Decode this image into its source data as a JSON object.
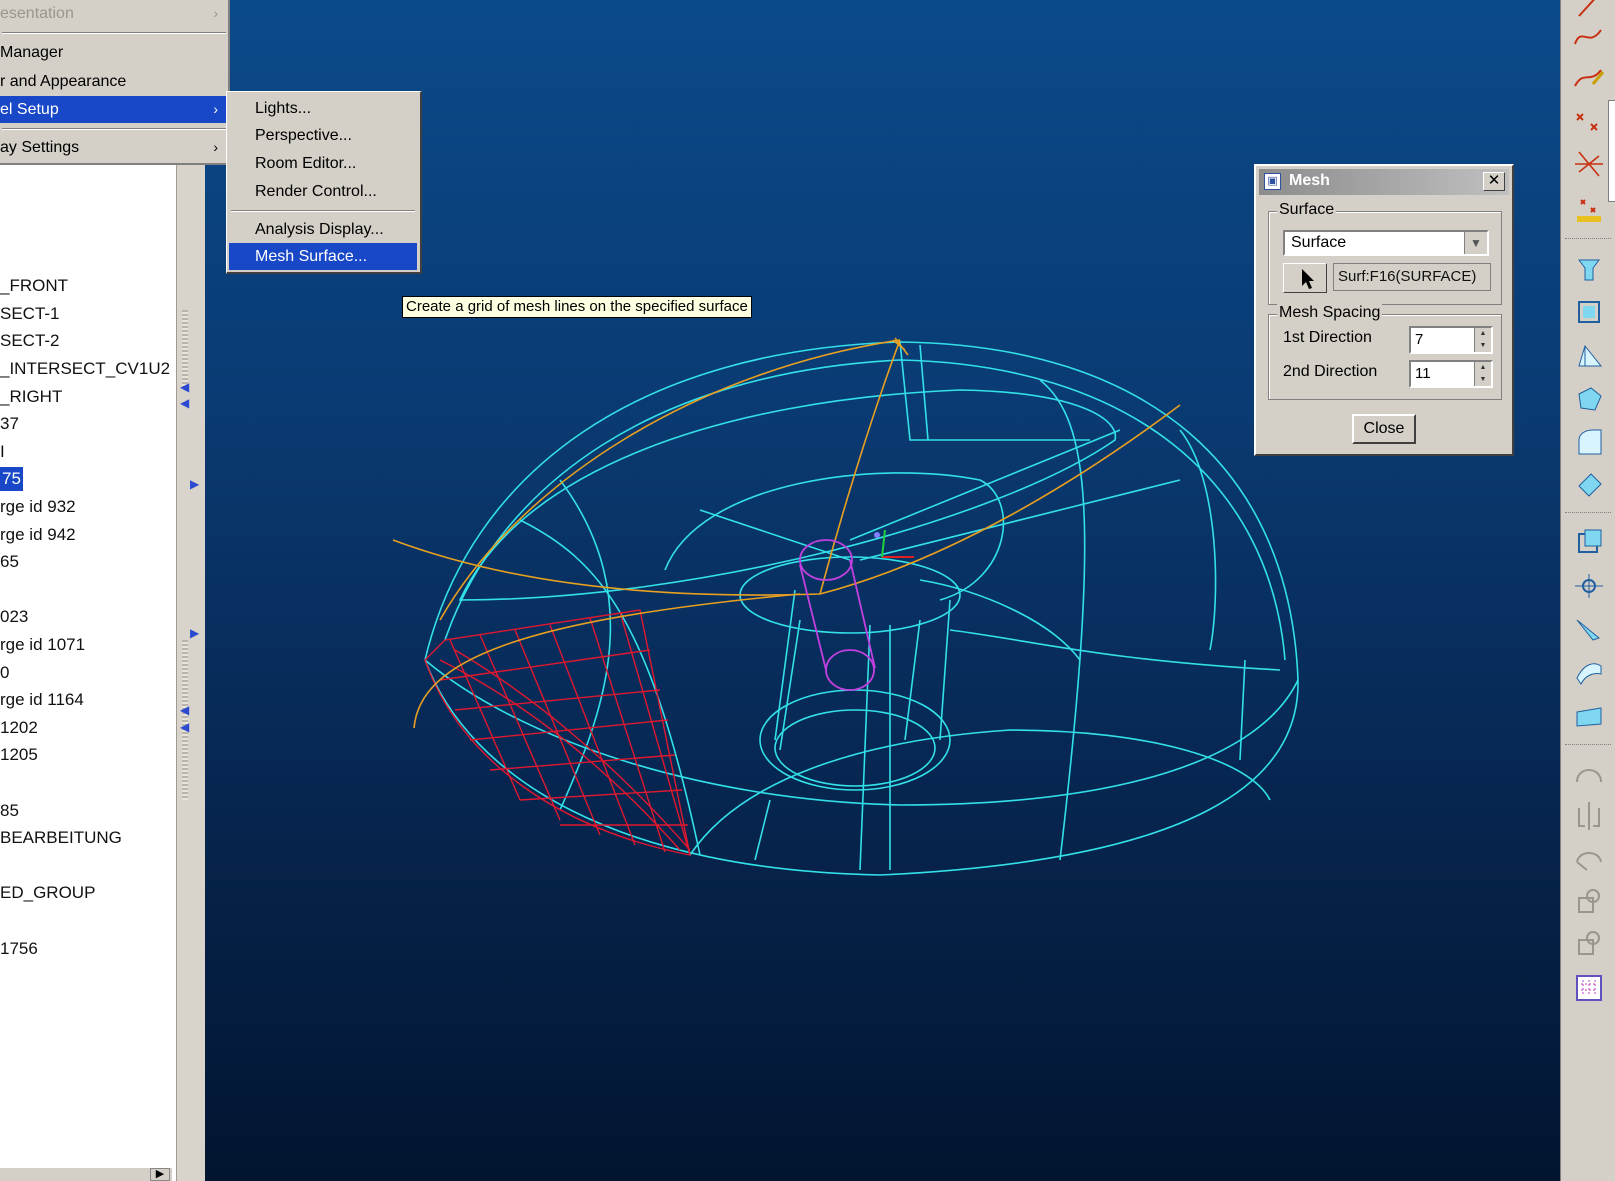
{
  "main_menu": {
    "items": [
      {
        "label": "esentation",
        "disabled": true,
        "has_submenu": true
      },
      {
        "label": "Manager"
      },
      {
        "label": "r and Appearance"
      },
      {
        "label": "el Setup",
        "active": true,
        "has_submenu": true
      },
      {
        "label": "ay Settings",
        "has_submenu": true
      }
    ]
  },
  "submenu": {
    "items": [
      {
        "label": "Lights..."
      },
      {
        "label": "Perspective..."
      },
      {
        "label": "Room Editor..."
      },
      {
        "label": "Render Control..."
      },
      {
        "label": "Analysis Display..."
      },
      {
        "label": "Mesh Surface...",
        "active": true
      }
    ]
  },
  "tooltip": "Create a grid of mesh lines on the specified surface",
  "model_tree": {
    "items": [
      "_FRONT",
      "SECT-1",
      "SECT-2",
      "_INTERSECT_CV1U2",
      "_RIGHT",
      "37",
      "I",
      "75",
      "rge id 932",
      "rge id 942",
      "65",
      "",
      "023",
      "rge id 1071",
      "0",
      "rge id 1164",
      "1202",
      "1205",
      "",
      "85",
      "BEARBEITUNG",
      "",
      "ED_GROUP",
      "",
      "1756"
    ],
    "selected_index": 7
  },
  "mesh_dialog": {
    "title": "Mesh",
    "surface_group_label": "Surface",
    "surface_select_value": "Surface",
    "surface_reference": "Surf:F16(SURFACE)",
    "spacing_group_label": "Mesh Spacing",
    "first_direction_label": "1st Direction",
    "first_direction_value": "7",
    "second_direction_label": "2nd Direction",
    "second_direction_value": "11",
    "close_label": "Close"
  },
  "colors": {
    "wireframe": "#33e0e8",
    "mesh": "#e01830",
    "curves": "#e8a020",
    "pivot": "#c040e0",
    "selection": "#1848c8",
    "viewport_top": "#0b4a8a",
    "viewport_bottom": "#021530"
  },
  "toolbar_icons": [
    "sketch-line-icon",
    "spline-icon",
    "curve-edit-icon",
    "datum-point-icon",
    "datum-point-offset-icon",
    "point-array-icon",
    "extrude-icon",
    "revolve-icon",
    "sweep-icon",
    "blend-icon",
    "round-icon",
    "chamfer-icon",
    "shell-icon",
    "pattern-icon",
    "draft-icon",
    "boundary-blend-icon",
    "surface-icon",
    "trim-icon",
    "mirror-icon",
    "merge-icon",
    "offset-icon",
    "thicken-icon",
    "mesh-grid-icon"
  ]
}
